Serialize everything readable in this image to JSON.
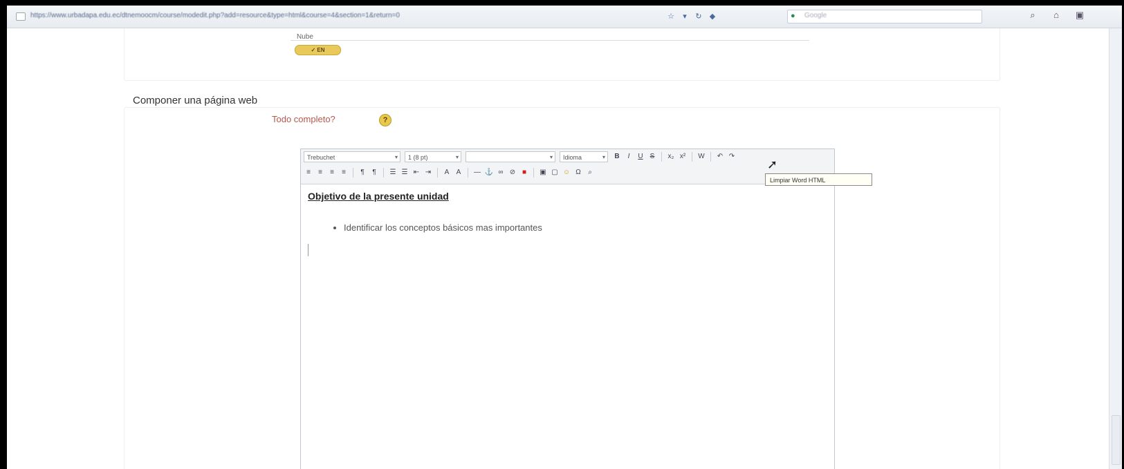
{
  "browser": {
    "url": "https://www.urbadapa.edu.ec/dtnemoocm/course/modedit.php?add=resource&type=html&course=4&section=1&return=0",
    "search_placeholder": "Google"
  },
  "previous_activity": {
    "label": "Nube",
    "edit_pill": "✓ EN"
  },
  "section": {
    "title": "Componer una página web",
    "all_complete": "Todo completo?",
    "help_icon": "?"
  },
  "editor": {
    "font_select": "Trebuchet",
    "size_select": "1 (8 pt)",
    "heading_select": "",
    "lang_select": "Idioma",
    "tooltip": "Limpiar Word HTML",
    "content": {
      "heading": "Objetivo de la presente unidad",
      "bullets": [
        "Identificar los conceptos básicos mas importantes"
      ]
    }
  }
}
